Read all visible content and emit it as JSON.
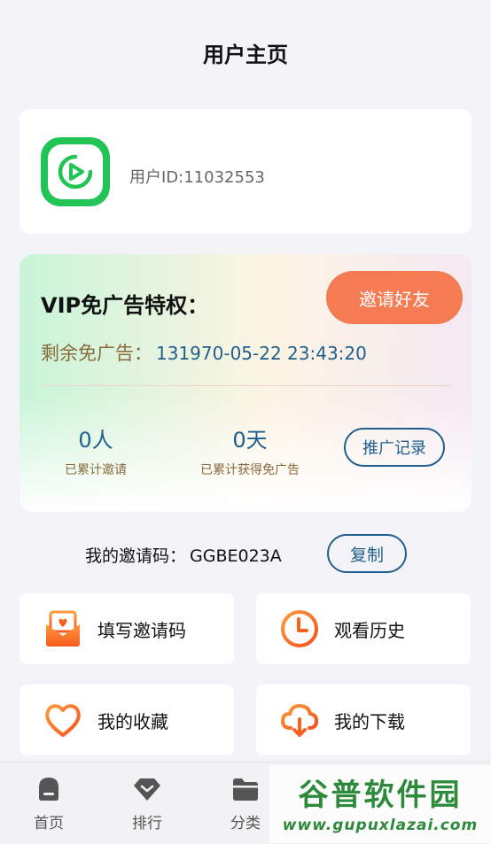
{
  "header": {
    "title": "用户主页"
  },
  "user": {
    "id_text": "用户ID:11032553"
  },
  "vip": {
    "title": "VIP免广告特权：",
    "invite_button": "邀请好友",
    "remaining_label": "剩余免广告：",
    "remaining_value": "131970-05-22 23:43:20",
    "invited_count": "0人",
    "invited_label": "已累计邀请",
    "days_value": "0天",
    "days_label": "已累计获得免广告",
    "promo_button": "推广记录"
  },
  "invite_code": {
    "label": "我的邀请码：",
    "value": "GGBE023A",
    "copy_button": "复制"
  },
  "tiles": [
    {
      "label": "填写邀请码",
      "icon": "envelope-heart-icon"
    },
    {
      "label": "观看历史",
      "icon": "clock-icon"
    },
    {
      "label": "我的收藏",
      "icon": "heart-icon"
    },
    {
      "label": "我的下载",
      "icon": "cloud-download-icon"
    }
  ],
  "bottom_nav": [
    {
      "label": "首页",
      "icon": "home-icon"
    },
    {
      "label": "排行",
      "icon": "diamond-icon"
    },
    {
      "label": "分类",
      "icon": "folder-icon"
    }
  ],
  "watermark": {
    "text": "谷普软件园",
    "url": "www.gupuxlazai.com"
  },
  "colors": {
    "accent_blue": "#1f5e8d",
    "invite_orange": "#f57b52",
    "avatar_green": "#22c455",
    "icon_orange": "#f5631f"
  }
}
